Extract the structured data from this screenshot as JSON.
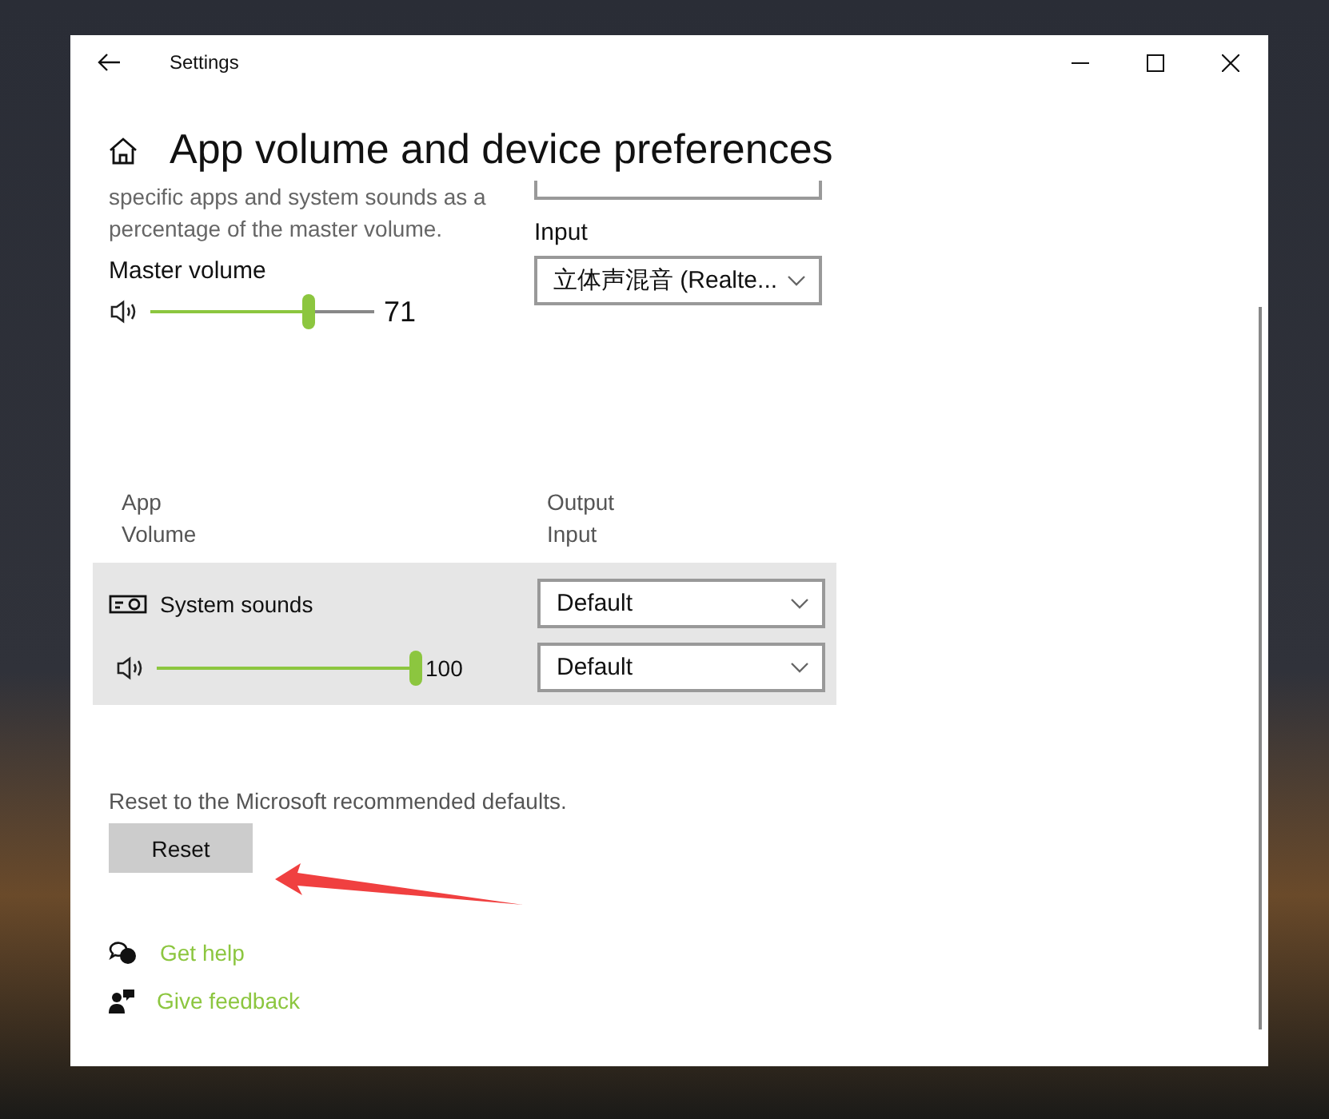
{
  "window": {
    "title": "Settings"
  },
  "page": {
    "title": "App volume and device preferences"
  },
  "master": {
    "description": "specific apps and system sounds as a percentage of the master volume.",
    "label": "Master volume",
    "level": 0.71,
    "reading": "71"
  },
  "input": {
    "label": "Input",
    "value": "立体声混音 (Realte..."
  },
  "columns": [
    {
      "line_1": "App",
      "line_2": "Volume"
    },
    {
      "line_1": "Output",
      "line_2": "Input"
    }
  ],
  "apps": [
    {
      "name": "System sounds",
      "level": 1.0,
      "reading": "100",
      "output": "Default",
      "input": "Default"
    }
  ],
  "reset": {
    "description": "Reset to the Microsoft recommended defaults.",
    "button": "Reset"
  },
  "links": [
    {
      "kind": "help",
      "label": "Get help"
    },
    {
      "kind": "feedback",
      "label": "Give feedback"
    }
  ]
}
